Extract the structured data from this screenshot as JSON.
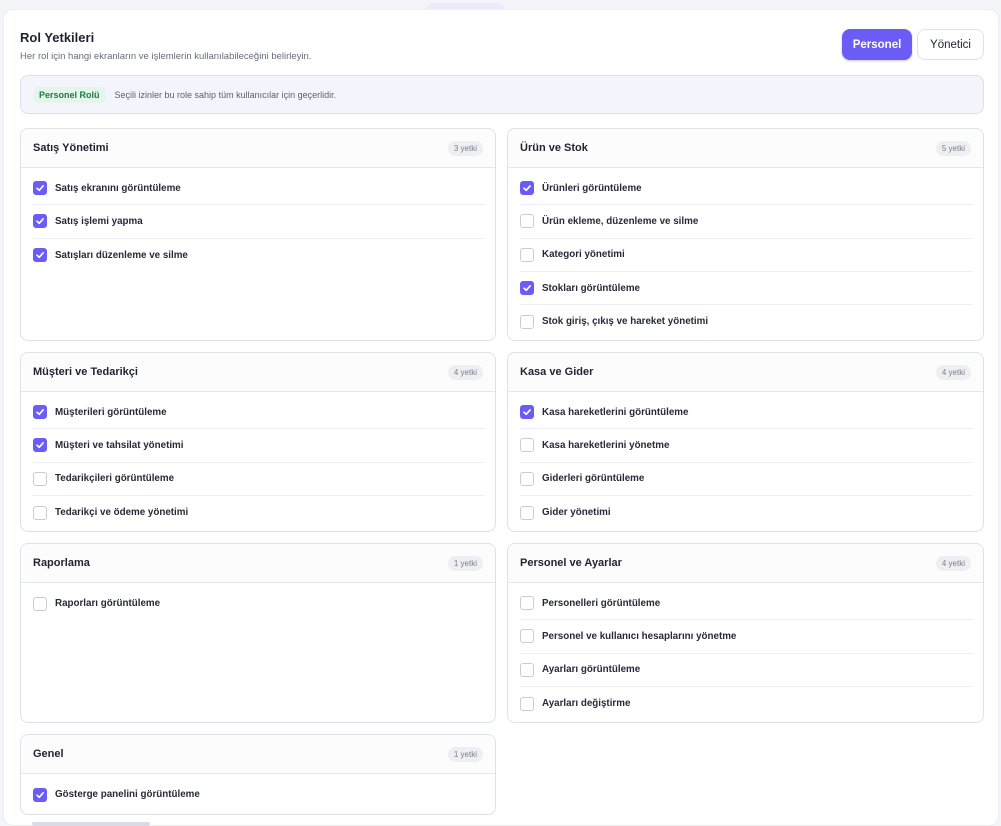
{
  "header": {
    "title": "Rol Yetkileri",
    "subtitle": "Her rol için hangi ekranların ve işlemlerin kullanılabileceğini belirleyin."
  },
  "roles": {
    "personel": "Personel",
    "yonetici": "Yönetici",
    "active": "Personel"
  },
  "info": {
    "badge": "Personel Rolü",
    "text": "Seçili izinler bu role sahip tüm kullanıcılar için geçerlidir."
  },
  "colors": {
    "accent": "#6b5cf6",
    "badge_green": "#1e7a45"
  },
  "groups": [
    {
      "title": "Satış Yönetimi",
      "count": "3 yetki",
      "items": [
        {
          "label": "Satış ekranını görüntüleme",
          "checked": true
        },
        {
          "label": "Satış işlemi yapma",
          "checked": true
        },
        {
          "label": "Satışları düzenleme ve silme",
          "checked": true
        }
      ]
    },
    {
      "title": "Ürün ve Stok",
      "count": "5 yetki",
      "items": [
        {
          "label": "Ürünleri görüntüleme",
          "checked": true
        },
        {
          "label": "Ürün ekleme, düzenleme ve silme",
          "checked": false
        },
        {
          "label": "Kategori yönetimi",
          "checked": false
        },
        {
          "label": "Stokları görüntüleme",
          "checked": true
        },
        {
          "label": "Stok giriş, çıkış ve hareket yönetimi",
          "checked": false
        }
      ]
    },
    {
      "title": "Müşteri ve Tedarikçi",
      "count": "4 yetki",
      "items": [
        {
          "label": "Müşterileri görüntüleme",
          "checked": true
        },
        {
          "label": "Müşteri ve tahsilat yönetimi",
          "checked": true
        },
        {
          "label": "Tedarikçileri görüntüleme",
          "checked": false
        },
        {
          "label": "Tedarikçi ve ödeme yönetimi",
          "checked": false
        }
      ]
    },
    {
      "title": "Kasa ve Gider",
      "count": "4 yetki",
      "items": [
        {
          "label": "Kasa hareketlerini görüntüleme",
          "checked": true
        },
        {
          "label": "Kasa hareketlerini yönetme",
          "checked": false
        },
        {
          "label": "Giderleri görüntüleme",
          "checked": false
        },
        {
          "label": "Gider yönetimi",
          "checked": false
        }
      ]
    },
    {
      "title": "Raporlama",
      "count": "1 yetki",
      "items": [
        {
          "label": "Raporları görüntüleme",
          "checked": false
        }
      ]
    },
    {
      "title": "Personel ve Ayarlar",
      "count": "4 yetki",
      "items": [
        {
          "label": "Personelleri görüntüleme",
          "checked": false
        },
        {
          "label": "Personel ve kullanıcı hesaplarını yönetme",
          "checked": false
        },
        {
          "label": "Ayarları görüntüleme",
          "checked": false
        },
        {
          "label": "Ayarları değiştirme",
          "checked": false
        }
      ]
    },
    {
      "title": "Genel",
      "count": "1 yetki",
      "items": [
        {
          "label": "Gösterge panelini görüntüleme",
          "checked": true
        }
      ]
    }
  ]
}
